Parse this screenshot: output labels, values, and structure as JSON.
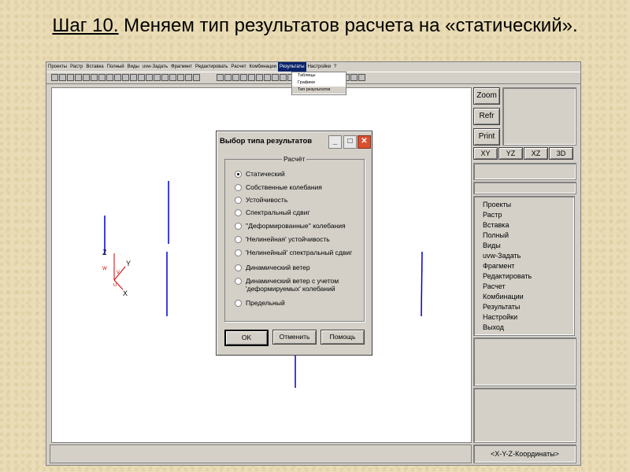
{
  "slide": {
    "step": "Шаг 10.",
    "title_rest": " Меняем тип результатов расчета на «статический»."
  },
  "app": {
    "menu": [
      "Проекты",
      "Растр",
      "Вставка",
      "Полный",
      "Виды",
      "uvw-Задать",
      "Фрагмент",
      "Редактировать",
      "Расчет",
      "Комбинации",
      "Результаты",
      "Настройки",
      "?"
    ],
    "active_menu_index": 10,
    "results_dropdown": [
      "Таблицы",
      "Графики",
      "Тип результатов"
    ],
    "selected_dropdown_index": 2
  },
  "right_panel": {
    "zoom": "Zoom",
    "refr": "Refr",
    "print": "Print",
    "views": [
      "XY",
      "YZ",
      "XZ",
      "3D"
    ],
    "menu": [
      "Проекты",
      "Растр",
      "Вставка",
      "Полный",
      "Виды",
      "uvw-Задать",
      "Фрагмент",
      "Редактировать",
      "Расчет",
      "Комбинации",
      "Результаты",
      "Настройки",
      "Выход"
    ],
    "coords": "<X-Y-Z-Координаты>"
  },
  "axes": {
    "z": "Z",
    "y": "Y",
    "x": "X",
    "w": "W",
    "v": "V",
    "u": "U"
  },
  "dialog": {
    "title": "Выбор типа результатов",
    "group": "Расчёт",
    "options": [
      {
        "label": "Статический",
        "checked": true
      },
      {
        "label": "Собственные колебания",
        "checked": false
      },
      {
        "label": "Устойчивость",
        "checked": false
      },
      {
        "label": "Спектральный сдвиг",
        "checked": false
      },
      {
        "label": "''Деформированные'' колебания",
        "checked": false
      },
      {
        "label": "'Нелинейная' устойчивость",
        "checked": false
      },
      {
        "label": "'Нелинейный' спектральный сдвиг",
        "checked": false
      },
      {
        "label": "Динамический ветер",
        "checked": false
      },
      {
        "label": "Динамический ветер с учетом\n'деформируемых' колебаний",
        "checked": false
      },
      {
        "label": "Предельный",
        "checked": false
      }
    ],
    "ok": "OK",
    "cancel": "Отменить",
    "help": "Помощь",
    "minimize": "_",
    "maximize": "□",
    "close": "✕"
  },
  "colors": {
    "lines": "#0000cc",
    "axis_red": "#d00000",
    "title_active": "#0a246a"
  }
}
